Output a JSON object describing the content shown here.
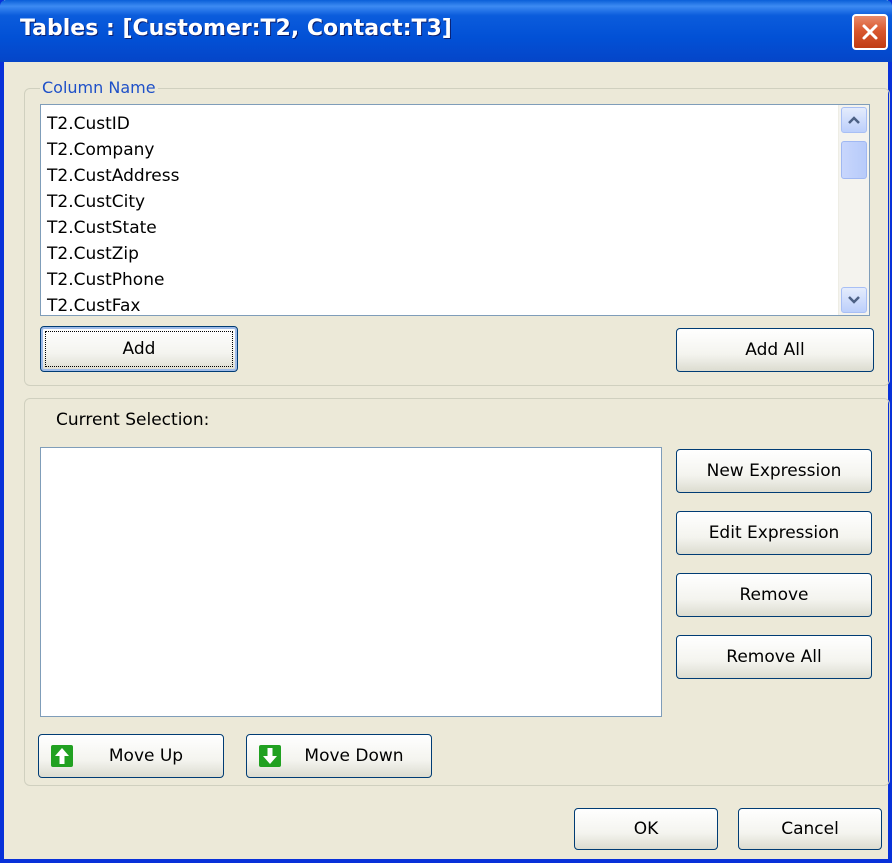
{
  "window": {
    "title": "Tables : [Customer:T2, Contact:T3]"
  },
  "column_group": {
    "legend": "Column Name",
    "items": [
      "T2.CustID",
      "T2.Company",
      "T2.CustAddress",
      "T2.CustCity",
      "T2.CustState",
      "T2.CustZip",
      "T2.CustPhone",
      "T2.CustFax"
    ],
    "add_label": "Add",
    "add_all_label": "Add All"
  },
  "selection_group": {
    "label": "Current Selection:",
    "new_expression_label": "New Expression",
    "edit_expression_label": "Edit Expression",
    "remove_label": "Remove",
    "remove_all_label": "Remove All",
    "move_up_label": "Move Up",
    "move_down_label": "Move Down"
  },
  "footer": {
    "ok_label": "OK",
    "cancel_label": "Cancel"
  },
  "icons": {
    "close": "close-icon",
    "scroll_up": "chevron-up-icon",
    "scroll_down": "chevron-down-icon",
    "move_up": "arrow-up-icon",
    "move_down": "arrow-down-icon"
  },
  "colors": {
    "titlebar": "#0251d6",
    "dialog_bg": "#ece9d8",
    "legend_text": "#1e50c8",
    "close_button": "#d9582f",
    "arrow_green": "#21a121"
  }
}
